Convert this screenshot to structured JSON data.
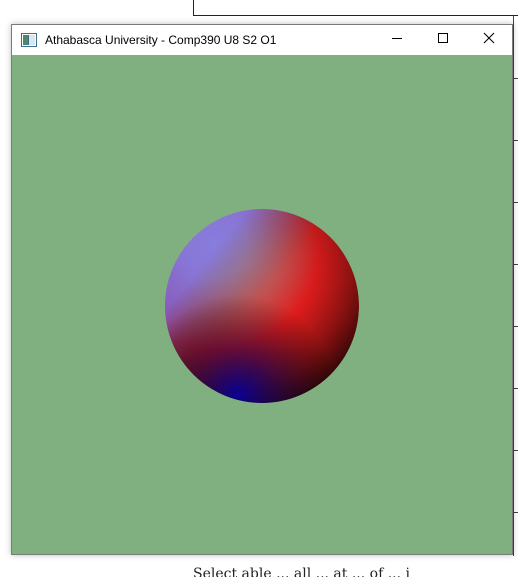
{
  "window": {
    "title": "Athabasca University - Comp390 U8 S2 O1",
    "controls": {
      "minimize_icon": "minimize-icon",
      "maximize_icon": "maximize-icon",
      "close_icon": "close-icon"
    }
  },
  "scene": {
    "background_color": "#80B080",
    "sphere": {
      "highlight_color": "#FFD0D0",
      "main_color": "#FF2020",
      "side_color": "#6060E0",
      "shadow_color": "#000000",
      "rim_blue": "#0000A0"
    }
  },
  "background_document": {
    "bottom_text": "Select able ... all ... at ... of ... i"
  }
}
